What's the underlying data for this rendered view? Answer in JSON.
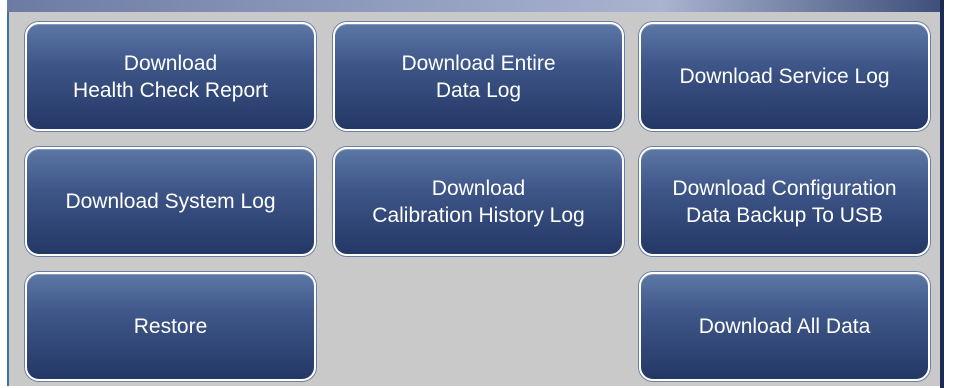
{
  "buttons": {
    "health_check": {
      "line1": "Download",
      "line2": "Health Check Report"
    },
    "entire_data_log": {
      "line1": "Download Entire",
      "line2": "Data Log"
    },
    "service_log": {
      "line1": "Download Service Log"
    },
    "system_log": {
      "line1": "Download System Log"
    },
    "calibration_history": {
      "line1": "Download",
      "line2": "Calibration History Log"
    },
    "config_backup": {
      "line1": "Download Configuration",
      "line2": "Data Backup To USB"
    },
    "restore": {
      "line1": "Restore"
    },
    "all_data": {
      "line1": "Download All Data"
    }
  },
  "colors": {
    "panel_background": "#c9c9c9",
    "button_top": "#5c77a6",
    "button_bottom": "#243866",
    "button_text": "#ffffff",
    "button_border": "#ffffff"
  }
}
